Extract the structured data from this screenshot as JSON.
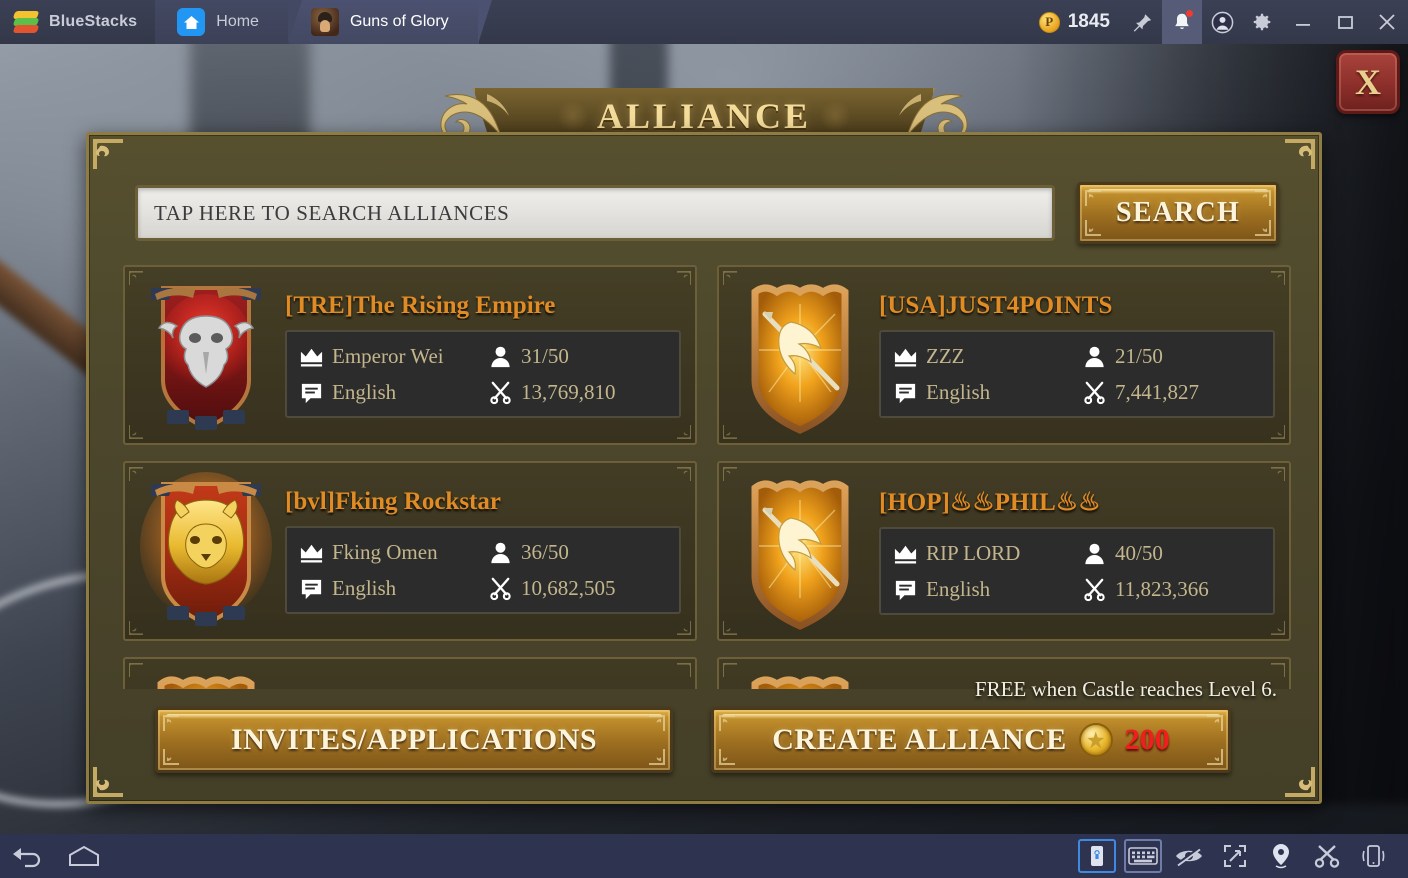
{
  "titlebar": {
    "brand": "BlueStacks",
    "tabs": [
      {
        "label": "Home",
        "icon": "home-icon"
      },
      {
        "label": "Guns of Glory",
        "icon": "game-icon"
      }
    ],
    "points": {
      "value": "1845",
      "symbol": "P"
    },
    "icons": [
      "pin-icon",
      "bell-icon",
      "account-icon",
      "gear-icon"
    ],
    "window_controls": [
      "minimize",
      "maximize",
      "close"
    ]
  },
  "game": {
    "title": "ALLIANCE",
    "close_label": "X",
    "search": {
      "placeholder": "TAP HERE TO SEARCH ALLIANCES",
      "value": "",
      "button_label": "SEARCH"
    },
    "alliances": [
      {
        "name": "[TRE]The Rising Empire",
        "leader": "Emperor Wei",
        "language": "English",
        "members": "31/50",
        "power": "13,769,810",
        "crest": "bull-skull-red"
      },
      {
        "name": "[USA]JUST4POINTS",
        "leader": "ZZZ",
        "language": "English",
        "members": "21/50",
        "power": "7,441,827",
        "crest": "golden-wing"
      },
      {
        "name": "[bvl]Fking Rockstar",
        "leader": "Fking Omen",
        "language": "English",
        "members": "36/50",
        "power": "10,682,505",
        "crest": "golden-lion"
      },
      {
        "name": "[HOP]♨♨PHIL♨♨",
        "leader": "RIP LORD",
        "language": "English",
        "members": "40/50",
        "power": "11,823,366",
        "crest": "golden-wing"
      }
    ],
    "footer": {
      "free_note": "FREE when Castle reaches Level 6.",
      "invites_label": "INVITES/APPLICATIONS",
      "create_label": "CREATE ALLIANCE",
      "create_cost": "200"
    },
    "colors": {
      "alliance_name": "#e08b24",
      "info_text": "#c3b68c",
      "gold_border": "#8f7c43",
      "cost_red": "#f21d1d",
      "panel_bg": "#4c472c"
    }
  },
  "android_bar": {
    "nav": [
      "back-icon",
      "home-icon"
    ],
    "tools": [
      "rotate-lock-icon",
      "keyboard-icon",
      "eye-slash-icon",
      "fullscreen-icon",
      "location-pin-icon",
      "scissors-icon",
      "shake-phone-icon"
    ]
  }
}
